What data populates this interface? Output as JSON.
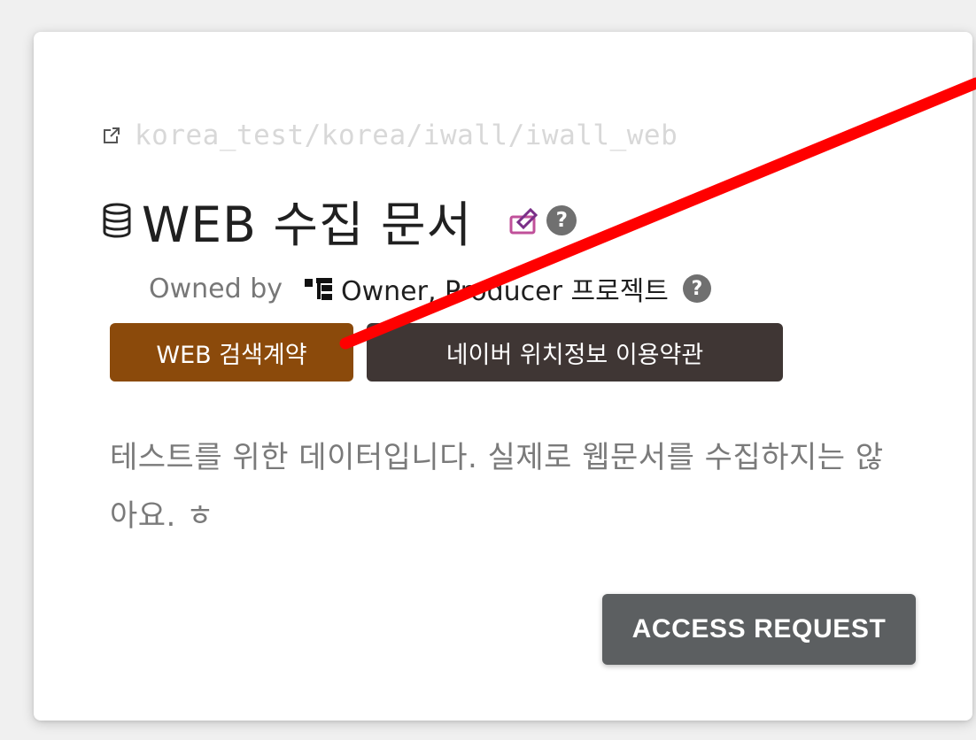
{
  "card": {
    "path": "korea_test/korea/iwall/iwall_web",
    "title": "WEB 수집 문서",
    "owned_by_label": "Owned by",
    "owner": "Owner, Producer 프로젝트",
    "help_glyph": "?",
    "tags": [
      {
        "label": "WEB 검색계약",
        "color": "#8b4a0b"
      },
      {
        "label": "네이버 위치정보 이용약관",
        "color": "#3f3634"
      }
    ],
    "description": "테스트를 위한 데이터입니다. 실제로 웹문서를 수집하지는 않아요. ㅎ",
    "access_button_label": "ACCESS REQUEST",
    "access_button_color": "#5c5f61"
  },
  "icons": {
    "external_link": "external-link-icon",
    "database": "database-icon",
    "edit": "edit-icon",
    "help": "help-icon",
    "organization": "org-chart-icon"
  },
  "annotation": {
    "color": "#ff0000",
    "shape": "arrow-line"
  }
}
